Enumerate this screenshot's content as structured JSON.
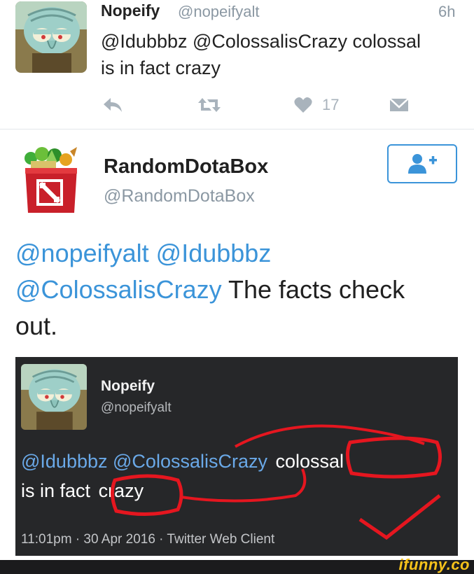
{
  "reply_tweet": {
    "name": "Nopeify",
    "handle": "@nopeifyalt",
    "time": "6h",
    "text_line1": "@Idubbbz @ColossalisCrazy colossal",
    "text_line2": "is in fact crazy",
    "like_count": "17",
    "icons": [
      "reply-icon",
      "retweet-icon",
      "heart-icon",
      "dm-icon"
    ]
  },
  "main_tweet": {
    "name": "RandomDotaBox",
    "handle": "@RandomDotaBox",
    "follow_icon": "add-user-icon",
    "mention1": "@nopeifyalt",
    "mention2": "@Idubbbz",
    "mention3": "@ColossalisCrazy",
    "text_rest": " The facts check",
    "text_end": "out."
  },
  "embedded_screenshot": {
    "name": "Nopeify",
    "handle": "@nopeifyalt",
    "mention1": "@Idubbbz",
    "mention2": "@ColossalisCrazy",
    "word_colossal": "colossal",
    "text_is_in_fact": "is in fact",
    "word_crazy": "crazy",
    "meta": "11:01pm · 30 Apr 2016 · Twitter Web Client",
    "annotation_color": "#e5161f"
  },
  "watermark": "ifunny.co"
}
